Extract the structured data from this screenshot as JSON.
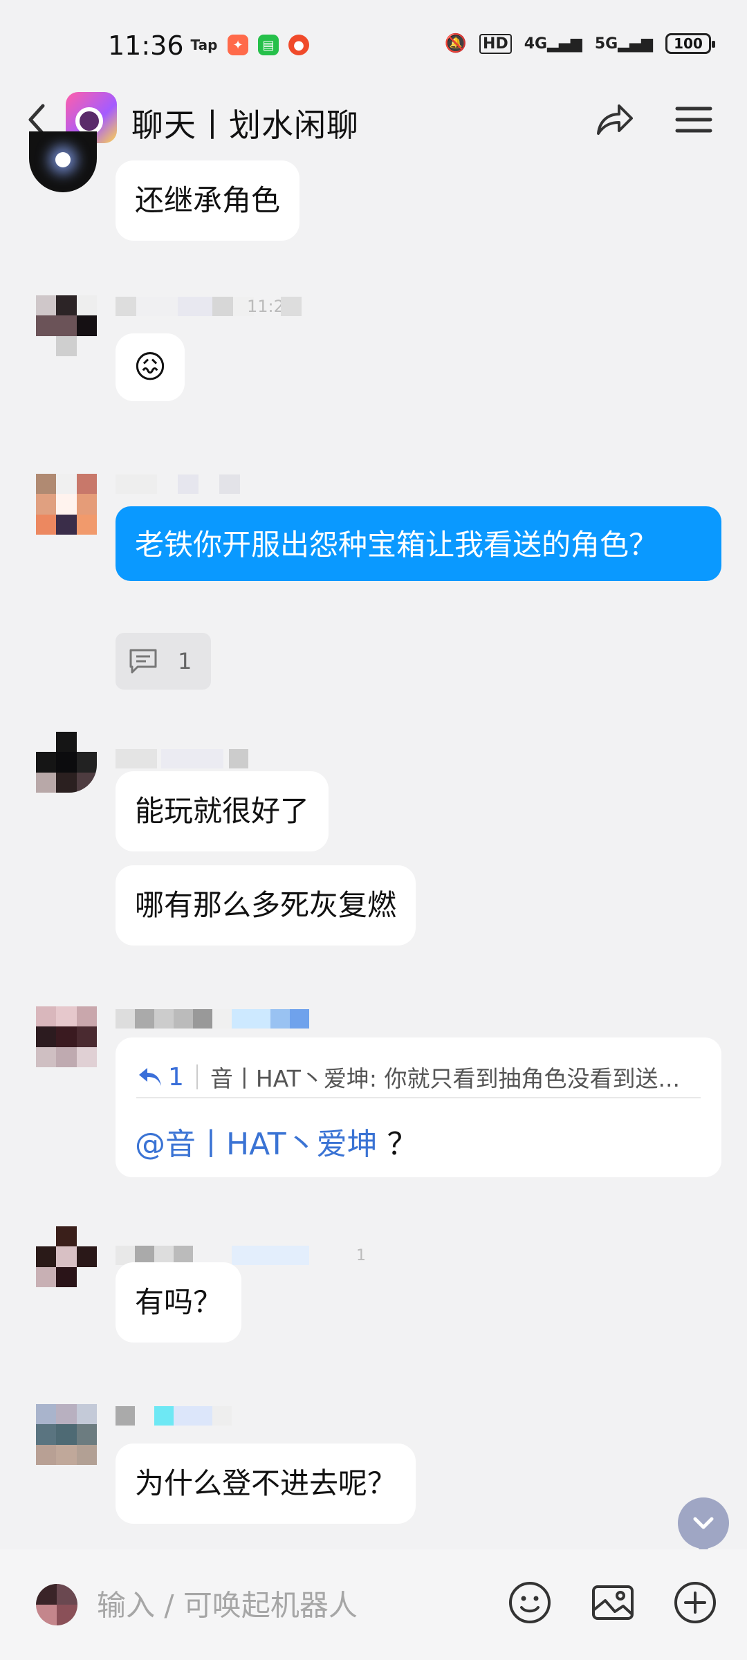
{
  "status_bar": {
    "time": "11:36",
    "apps": [
      "Tap",
      "game",
      "chat",
      "weibo"
    ],
    "network": [
      "HD",
      "4G",
      "5G"
    ],
    "battery": "100"
  },
  "header": {
    "title": "聊天丨划水闲聊"
  },
  "messages": [
    {
      "text": "还继承角色"
    },
    {
      "time": "11:21",
      "emoji": "😖"
    },
    {
      "text": "老铁你开服出怨种宝箱让我看送的角色？",
      "reply_count": "1"
    },
    {
      "text": "能玩就很好了"
    },
    {
      "text": "哪有那么多死灰复燃"
    },
    {
      "quote": {
        "count": "1",
        "text": "音丨HAT丶爱坤: 你就只看到抽角色没看到送...",
        "mention": "@音丨HAT丶爱坤",
        "suffix": " ？"
      }
    },
    {
      "text": "有吗？",
      "badge": "1"
    },
    {
      "text": "为什么登不进去呢？"
    }
  ],
  "input": {
    "placeholder": "输入 / 可唤起机器人"
  },
  "icons": [
    "back-icon",
    "share-icon",
    "menu-icon",
    "comment-icon",
    "reply-icon",
    "chevron-down-icon",
    "emoji-icon",
    "image-icon",
    "plus-icon"
  ],
  "colors": {
    "accent_blue": "#0a99ff",
    "mention_blue": "#3a73d4",
    "background": "#f2f2f3"
  }
}
